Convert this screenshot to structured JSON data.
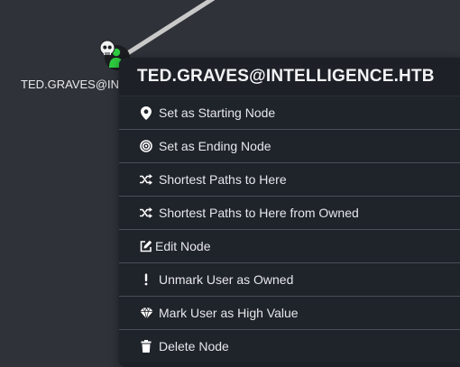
{
  "node": {
    "label": "TED.GRAVES@INTELLIGENCE.HTB",
    "icon": "owned-user-skull-icon"
  },
  "menu": {
    "title": "TED.GRAVES@INTELLIGENCE.HTB",
    "items": [
      {
        "label": "Set as Starting Node",
        "icon": "map-marker-icon"
      },
      {
        "label": "Set as Ending Node",
        "icon": "bullseye-icon"
      },
      {
        "label": "Shortest Paths to Here",
        "icon": "random-icon"
      },
      {
        "label": "Shortest Paths to Here from Owned",
        "icon": "random-icon"
      },
      {
        "label": "Edit Node",
        "icon": "edit-icon"
      },
      {
        "label": "Unmark User as Owned",
        "icon": "exclamation-icon"
      },
      {
        "label": "Mark User as High Value",
        "icon": "gem-icon"
      },
      {
        "label": "Delete Node",
        "icon": "trash-icon"
      }
    ]
  },
  "colors": {
    "canvas": "#2f3339",
    "menu_bg": "#1d2127",
    "separator": "#4a4f57",
    "edge": "#c8c8c8",
    "node_green": "#2ecc40"
  }
}
